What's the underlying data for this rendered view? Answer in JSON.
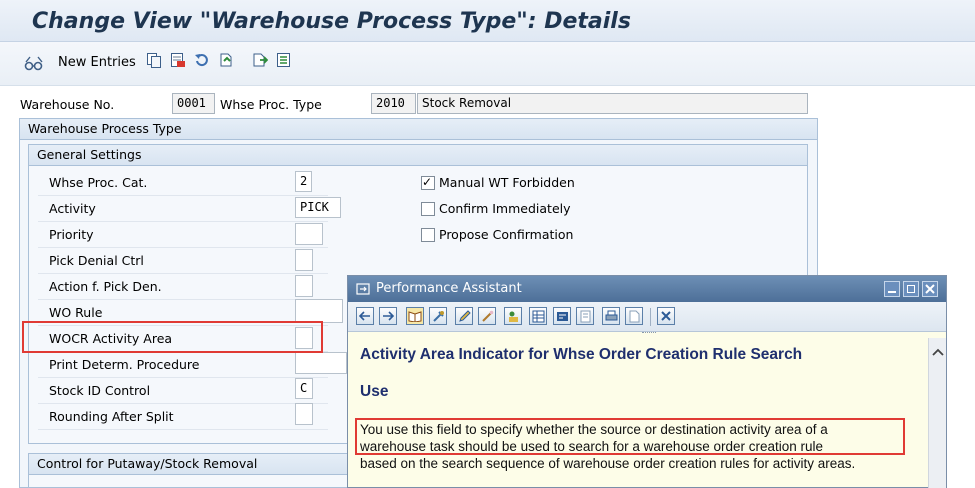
{
  "window": {
    "title": "Change View \"Warehouse Process Type\": Details"
  },
  "toolbar": {
    "new_entries_label": "New Entries"
  },
  "header": {
    "warehouse_label": "Warehouse No.",
    "warehouse_value": "0001",
    "whse_proc_type_label": "Whse Proc. Type",
    "whse_proc_type_value": "2010",
    "whse_proc_type_desc": "Stock Removal"
  },
  "group_outer": {
    "title": "Warehouse Process Type"
  },
  "general_settings": {
    "title": "General Settings",
    "rows": [
      {
        "label": "Whse Proc. Cat.",
        "value": "2"
      },
      {
        "label": "Activity",
        "value": "PICK"
      },
      {
        "label": "Priority",
        "value": ""
      },
      {
        "label": "Pick Denial Ctrl",
        "value": ""
      },
      {
        "label": "Action f. Pick Den.",
        "value": ""
      },
      {
        "label": "WO Rule",
        "value": ""
      },
      {
        "label": "WOCR Activity Area",
        "value": ""
      },
      {
        "label": "Print Determ. Procedure",
        "value": ""
      },
      {
        "label": "Stock ID Control",
        "value": "C"
      },
      {
        "label": "Rounding After Split",
        "value": ""
      }
    ],
    "checkboxes": [
      {
        "label": "Manual WT Forbidden",
        "checked": true,
        "mark": "✓"
      },
      {
        "label": "Confirm Immediately",
        "checked": false,
        "mark": ""
      },
      {
        "label": "Propose Confirmation",
        "checked": false,
        "mark": ""
      }
    ]
  },
  "putaway_group": {
    "title": "Control for Putaway/Stock Removal"
  },
  "performance_assistant": {
    "title": "Performance Assistant",
    "heading": "Activity Area Indicator for Whse Order Creation Rule Search",
    "section": "Use",
    "lines": [
      "You use this field to specify whether the source or destination activity area of a",
      "warehouse task should be used to search for a warehouse order creation rule",
      "based on the search sequence of warehouse order creation rules for activity areas."
    ]
  },
  "colors": {
    "highlight": "#e03a34",
    "title_text": "#1e3550",
    "pa_title_bar": "#5b7fa8",
    "pa_heading": "#1f2f6e"
  }
}
